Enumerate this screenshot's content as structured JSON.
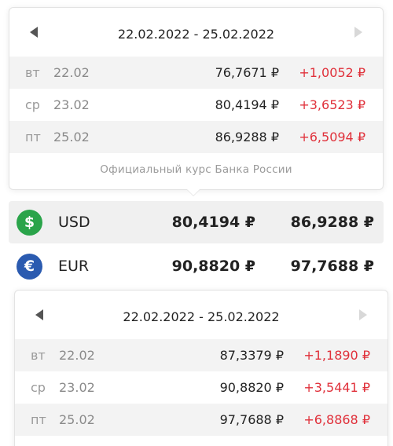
{
  "usd_popup": {
    "range": "22.02.2022 - 25.02.2022",
    "rows": [
      {
        "dow": "вт",
        "date": "22.02",
        "rate": "76,7671 ₽",
        "change": "+1,0052 ₽"
      },
      {
        "dow": "ср",
        "date": "23.02",
        "rate": "80,4194 ₽",
        "change": "+3,6523 ₽"
      },
      {
        "dow": "пт",
        "date": "25.02",
        "rate": "86,9288 ₽",
        "change": "+6,5094 ₽"
      }
    ],
    "footer": "Официальный курс Банка России"
  },
  "currencies": [
    {
      "code": "USD",
      "symbol": "$",
      "prev": "80,4194 ₽",
      "curr": "86,9288 ₽",
      "icon": "dollar-icon",
      "color": "#2aa44a"
    },
    {
      "code": "EUR",
      "symbol": "€",
      "prev": "90,8820 ₽",
      "curr": "97,7688 ₽",
      "icon": "euro-icon",
      "color": "#2b5bb0"
    }
  ],
  "eur_popup": {
    "range": "22.02.2022 - 25.02.2022",
    "rows": [
      {
        "dow": "вт",
        "date": "22.02",
        "rate": "87,3379 ₽",
        "change": "+1,1890 ₽"
      },
      {
        "dow": "ср",
        "date": "23.02",
        "rate": "90,8820 ₽",
        "change": "+3,5441 ₽"
      },
      {
        "dow": "пт",
        "date": "25.02",
        "rate": "97,7688 ₽",
        "change": "+6,8868 ₽"
      }
    ]
  },
  "colors": {
    "change_positive": "#e0303a",
    "row_shade": "#f3f3f3"
  }
}
